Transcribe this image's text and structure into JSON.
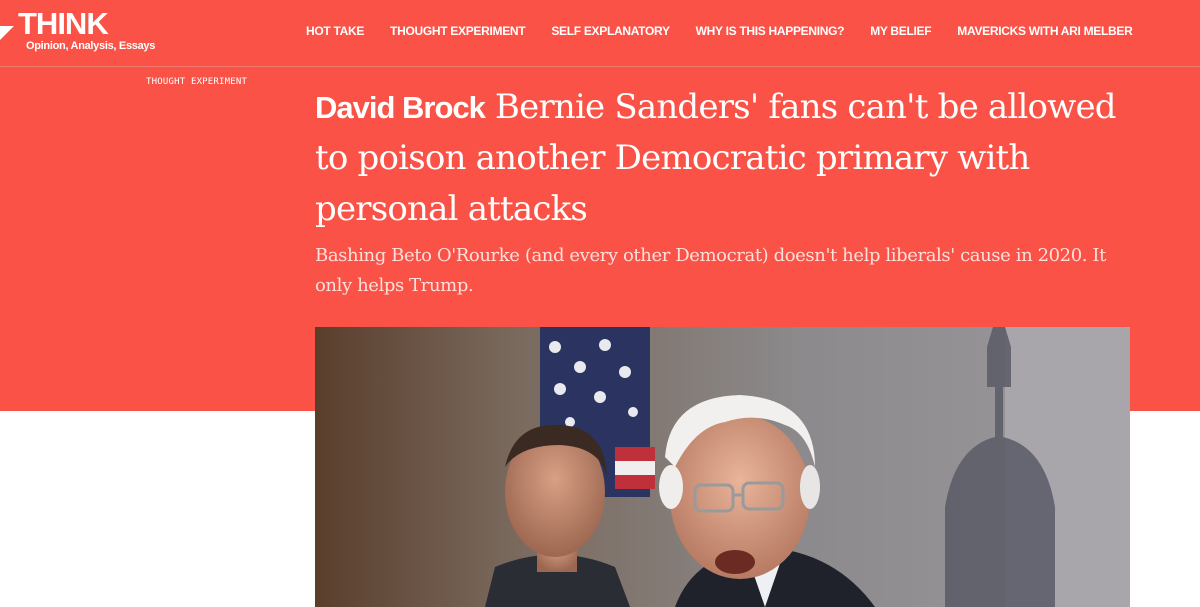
{
  "site": {
    "logo_title": "THINK",
    "logo_tagline": "Opinion, Analysis, Essays",
    "brand_color": "#fa5246"
  },
  "nav": {
    "items": [
      "HOT TAKE",
      "THOUGHT EXPERIMENT",
      "SELF EXPLANATORY",
      "WHY IS THIS HAPPENING?",
      "MY BELIEF",
      "MAVERICKS WITH ARI MELBER"
    ]
  },
  "article": {
    "section": "THOUGHT EXPERIMENT",
    "author": "David Brock",
    "headline": "Bernie Sanders' fans can't be allowed to poison another Democratic primary with personal attacks",
    "dek": "Bashing Beto O'Rourke (and every other Democrat) doesn't help liberals' cause in 2020. It only helps Trump.",
    "hero_image_icon": "photo-two-men-flag-capitol"
  }
}
